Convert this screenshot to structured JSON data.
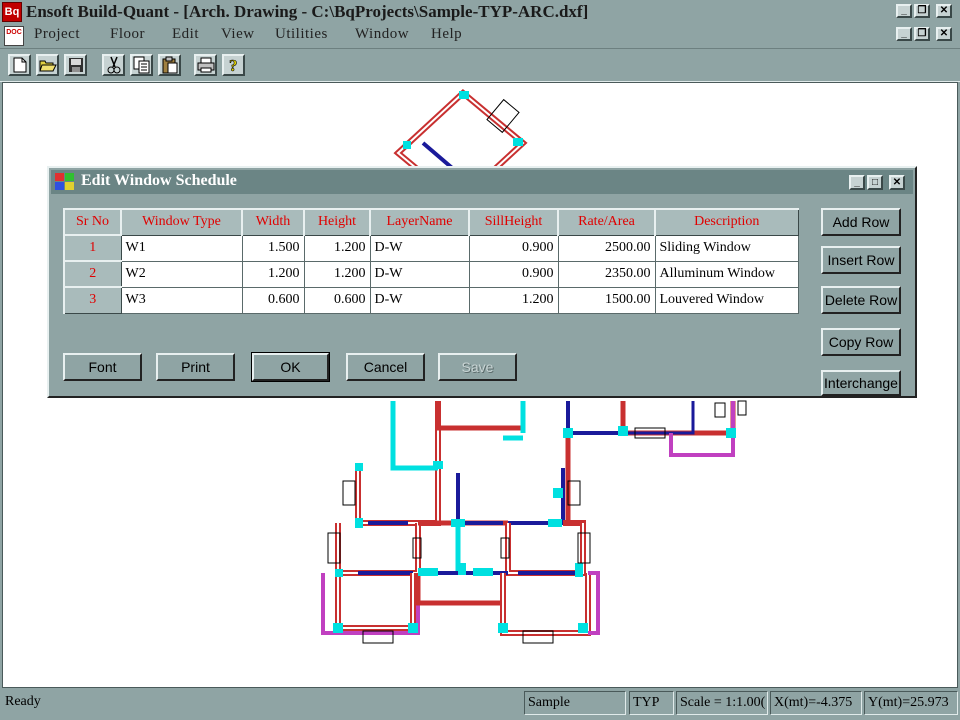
{
  "app": {
    "title": "Ensoft Build-Quant - [Arch. Drawing - C:\\BqProjects\\Sample-TYP-ARC.dxf]",
    "icon_text": "Bq"
  },
  "menu": [
    {
      "label": "Project"
    },
    {
      "label": "Floor"
    },
    {
      "label": "Edit"
    },
    {
      "label": "View"
    },
    {
      "label": "Utilities"
    },
    {
      "label": "Window"
    },
    {
      "label": "Help"
    }
  ],
  "toolbar": {
    "icons": [
      "new-file-icon",
      "open-folder-icon",
      "save-icon",
      "cut-icon",
      "copy-icon",
      "paste-icon",
      "print-icon",
      "help-icon"
    ]
  },
  "dialog": {
    "title": "Edit Window Schedule",
    "columns": [
      "Sr No",
      "Window Type",
      "Width",
      "Height",
      "LayerName",
      "SillHeight",
      "Rate/Area",
      "Description"
    ],
    "rows": [
      {
        "sr": "1",
        "type": "W1",
        "width": "1.500",
        "height": "1.200",
        "layer": "D-W",
        "sill": "0.900",
        "rate": "2500.00",
        "desc": "Sliding Window"
      },
      {
        "sr": "2",
        "type": "W2",
        "width": "1.200",
        "height": "1.200",
        "layer": "D-W",
        "sill": "0.900",
        "rate": "2350.00",
        "desc": "Alluminum Window"
      },
      {
        "sr": "3",
        "type": "W3",
        "width": "0.600",
        "height": "0.600",
        "layer": "D-W",
        "sill": "1.200",
        "rate": "1500.00",
        "desc": "Louvered Window"
      }
    ],
    "side_buttons": [
      "Add Row",
      "Insert Row",
      "Delete Row",
      "Copy Row",
      "Interchange"
    ],
    "bottom_buttons": [
      "Font",
      "Print",
      "OK",
      "Cancel",
      "Save"
    ]
  },
  "status": {
    "ready": "Ready",
    "project": "Sample",
    "floor": "TYP",
    "scale": "Scale = 1:1.00(",
    "x": "X(mt)=-4.375",
    "y": "Y(mt)=25.973"
  },
  "colors": {
    "chrome": "#8fa4a4",
    "dialog_title": "#6b8585",
    "header_text": "#e00000",
    "wall_red": "#c83030",
    "wall_cyan": "#00e0e0",
    "wall_blue": "#1a1a9a",
    "wall_magenta": "#c040c0"
  }
}
